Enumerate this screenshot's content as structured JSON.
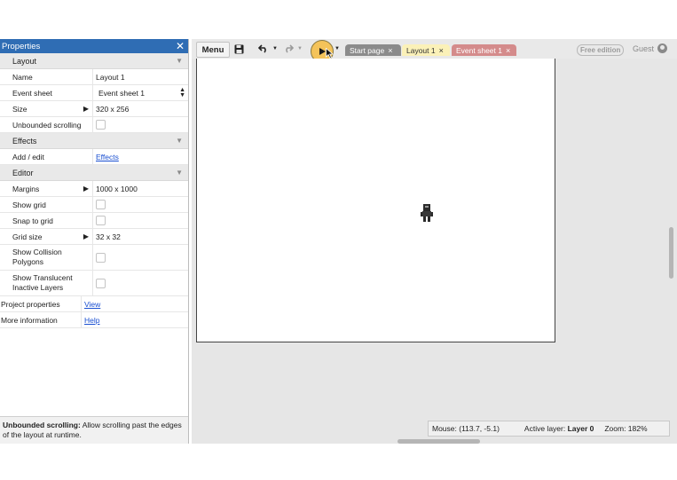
{
  "properties": {
    "title": "Properties",
    "sections": {
      "layout": {
        "label": "Layout",
        "name_label": "Name",
        "name_value": "Layout 1",
        "event_sheet_label": "Event sheet",
        "event_sheet_value": "Event sheet 1",
        "size_label": "Size",
        "size_value": "320 x 256",
        "unbounded_label": "Unbounded scrolling"
      },
      "effects": {
        "label": "Effects",
        "add_edit_label": "Add / edit",
        "add_edit_link": "Effects"
      },
      "editor": {
        "label": "Editor",
        "margins_label": "Margins",
        "margins_value": "1000 x 1000",
        "show_grid_label": "Show grid",
        "snap_label": "Snap to grid",
        "grid_size_label": "Grid size",
        "grid_size_value": "32 x 32",
        "collision_label_1": "Show Collision",
        "collision_label_2": "Polygons",
        "translucent_label_1": "Show Translucent",
        "translucent_label_2": "Inactive Layers"
      }
    },
    "project_label": "Project properties",
    "project_link": "View",
    "more_label": "More information",
    "more_link": "Help",
    "help_bold": "Unbounded scrolling:",
    "help_text": " Allow scrolling past the edges of the layout at runtime."
  },
  "toolbar": {
    "menu_label": "Menu",
    "tabs": [
      {
        "label": "Start page",
        "color": "#8b8b8b"
      },
      {
        "label": "Layout 1",
        "color": "#fbf1b8"
      },
      {
        "label": "Event sheet 1",
        "color": "#d48b8b"
      }
    ],
    "edition_badge": "Free edition",
    "user": "Guest",
    "run_color": "#f4c35a"
  },
  "status": {
    "mouse": "Mouse: (113.7, -5.1)",
    "layer_label": "Active layer: ",
    "layer_value": "Layer 0",
    "zoom": "Zoom: 182%"
  },
  "colors": {
    "panel_header": "#2f6db4",
    "link": "#1a4fd1"
  }
}
